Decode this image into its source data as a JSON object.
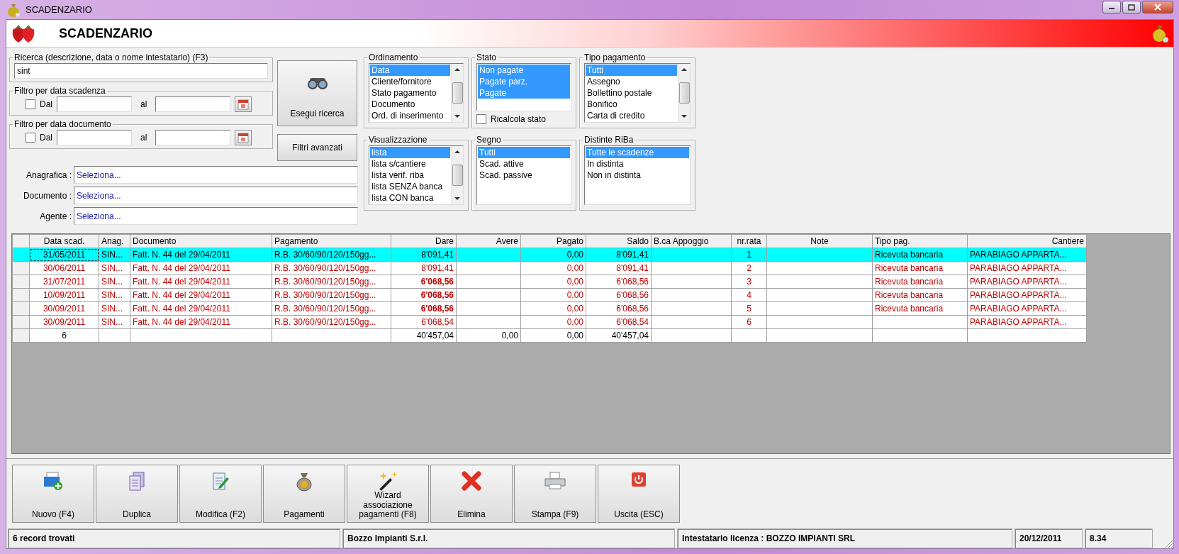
{
  "window": {
    "title": "SCADENZARIO"
  },
  "header": {
    "title": "SCADENZARIO"
  },
  "search": {
    "label": "Ricerca (descrizione, data o nome intestatario) (F3)",
    "value": "sint"
  },
  "date_filters": [
    {
      "label": "Filtro per data scadenza",
      "checked": false,
      "from_label": "Dal",
      "to_label": "al"
    },
    {
      "label": "Filtro per data documento",
      "checked": false,
      "from_label": "Dal",
      "to_label": "al"
    }
  ],
  "search_button": "Esegui ricerca",
  "advanced_button": "Filtri avanzati",
  "lookups": [
    {
      "label": "Anagrafica :",
      "value": "Seleziona..."
    },
    {
      "label": "Documento :",
      "value": "Seleziona..."
    },
    {
      "label": "Agente :",
      "value": "Seleziona..."
    }
  ],
  "listboxes": [
    {
      "title": "Ordinamento",
      "kind": "scrolling",
      "items": [
        {
          "label": "Data",
          "selected": true
        },
        {
          "label": "Cliente/fornitore",
          "selected": false
        },
        {
          "label": "Stato pagamento",
          "selected": false
        },
        {
          "label": "Documento",
          "selected": false
        },
        {
          "label": "Ord. di inserimento",
          "selected": false
        }
      ]
    },
    {
      "title": "Stato",
      "kind": "check",
      "check_label": "Ricalcola stato",
      "checked": false,
      "items": [
        {
          "label": "Non pagate",
          "selected": true
        },
        {
          "label": "Pagate parz.",
          "selected": true
        },
        {
          "label": "Pagate",
          "selected": true
        }
      ]
    },
    {
      "title": "Tipo pagamento",
      "kind": "scrolling",
      "items": [
        {
          "label": "Tutti",
          "selected": true
        },
        {
          "label": "Assegno",
          "selected": false
        },
        {
          "label": "Bollettino postale",
          "selected": false
        },
        {
          "label": "Bonifico",
          "selected": false
        },
        {
          "label": "Carta di credito",
          "selected": false
        }
      ]
    },
    {
      "title": "Visualizzazione",
      "kind": "scrolling",
      "items": [
        {
          "label": "lista",
          "selected": true
        },
        {
          "label": "lista s/cantiere",
          "selected": false
        },
        {
          "label": "lista verif. riba",
          "selected": false
        },
        {
          "label": "lista SENZA banca",
          "selected": false
        },
        {
          "label": "lista CON banca",
          "selected": false
        }
      ]
    },
    {
      "title": "Segno",
      "kind": "plain",
      "items": [
        {
          "label": "Tutti",
          "selected": true
        },
        {
          "label": "Scad. attive",
          "selected": false
        },
        {
          "label": "Scad. passive",
          "selected": false
        }
      ]
    },
    {
      "title": "Distinte RiBa",
      "kind": "plain",
      "items": [
        {
          "label": "Tutte le scadenze",
          "selected": true
        },
        {
          "label": "In distinta",
          "selected": false
        },
        {
          "label": "Non in distinta",
          "selected": false
        }
      ]
    }
  ],
  "table": {
    "columns": [
      "Data scad.",
      "Anag.",
      "Documento",
      "Pagamento",
      "Dare",
      "Avere",
      "Pagato",
      "Saldo",
      "B.ca Appoggio",
      "nr.rata",
      "Note",
      "Tipo pag.",
      "Cantiere"
    ],
    "rows": [
      {
        "kind": "entry",
        "selected": true,
        "dare_bold": false,
        "date": "31/05/2011",
        "anag": "SIN...",
        "document": "Fatt. N. 44 del 29/04/2011",
        "payment": "R.B. 30/60/90/120/150gg...",
        "dare": "8'091,41",
        "pagato": "0,00",
        "saldo": "8'091,41",
        "rata": "1",
        "tipo_pag": "Ricevuta bancaria",
        "cantiere": "PARABIAGO APPARTA..."
      },
      {
        "kind": "entry",
        "selected": false,
        "dare_bold": false,
        "date": "30/06/2011",
        "anag": "SIN...",
        "document": "Fatt. N. 44 del 29/04/2011",
        "payment": "R.B. 30/60/90/120/150gg...",
        "dare": "8'091,41",
        "pagato": "0,00",
        "saldo": "8'091,41",
        "rata": "2",
        "tipo_pag": "Ricevuta bancaria",
        "cantiere": "PARABIAGO APPARTA..."
      },
      {
        "kind": "entry",
        "selected": false,
        "dare_bold": true,
        "date": "31/07/2011",
        "anag": "SIN...",
        "document": "Fatt. N. 44 del 29/04/2011",
        "payment": "R.B. 30/60/90/120/150gg...",
        "dare": "6'068,56",
        "pagato": "0,00",
        "saldo": "6'068,56",
        "rata": "3",
        "tipo_pag": "Ricevuta bancaria",
        "cantiere": "PARABIAGO APPARTA..."
      },
      {
        "kind": "entry",
        "selected": false,
        "dare_bold": true,
        "date": "10/09/2011",
        "anag": "SIN...",
        "document": "Fatt. N. 44 del 29/04/2011",
        "payment": "R.B. 30/60/90/120/150gg...",
        "dare": "6'068,56",
        "pagato": "0,00",
        "saldo": "6'068,56",
        "rata": "4",
        "tipo_pag": "Ricevuta bancaria",
        "cantiere": "PARABIAGO APPARTA..."
      },
      {
        "kind": "entry",
        "selected": false,
        "dare_bold": true,
        "date": "30/09/2011",
        "anag": "SIN...",
        "document": "Fatt. N. 44 del 29/04/2011",
        "payment": "R.B. 30/60/90/120/150gg...",
        "dare": "6'068,56",
        "pagato": "0,00",
        "saldo": "6'068,56",
        "rata": "5",
        "tipo_pag": "Ricevuta bancaria",
        "cantiere": "PARABIAGO APPARTA..."
      },
      {
        "kind": "entry",
        "selected": false,
        "dare_bold": false,
        "date": "30/09/2011",
        "anag": "SIN...",
        "document": "Fatt. N. 44 del 29/04/2011",
        "payment": "R.B. 30/60/90/120/150gg...",
        "dare": "6'068,54",
        "pagato": "0,00",
        "saldo": "6'068,54",
        "rata": "6",
        "cantiere": "PARABIAGO APPARTA..."
      },
      {
        "kind": "total",
        "selected": false,
        "dare_bold": false,
        "date": "6",
        "dare": "40'457,04",
        "avere": "0,00",
        "pagato": "0,00",
        "saldo": "40'457,04"
      }
    ]
  },
  "toolbar": [
    "Nuovo (F4)",
    "Duplica",
    "Modifica (F2)",
    "Pagamenti",
    "Wizard associazione pagamenti (F8)",
    "Elimina",
    "Stampa (F9)",
    "Uscita (ESC)"
  ],
  "status_bar": [
    "6 record trovati",
    "Bozzo Impianti S.r.l.",
    "Intestatario licenza : BOZZO IMPIANTI SRL",
    "20/12/2011",
    "8.34"
  ]
}
